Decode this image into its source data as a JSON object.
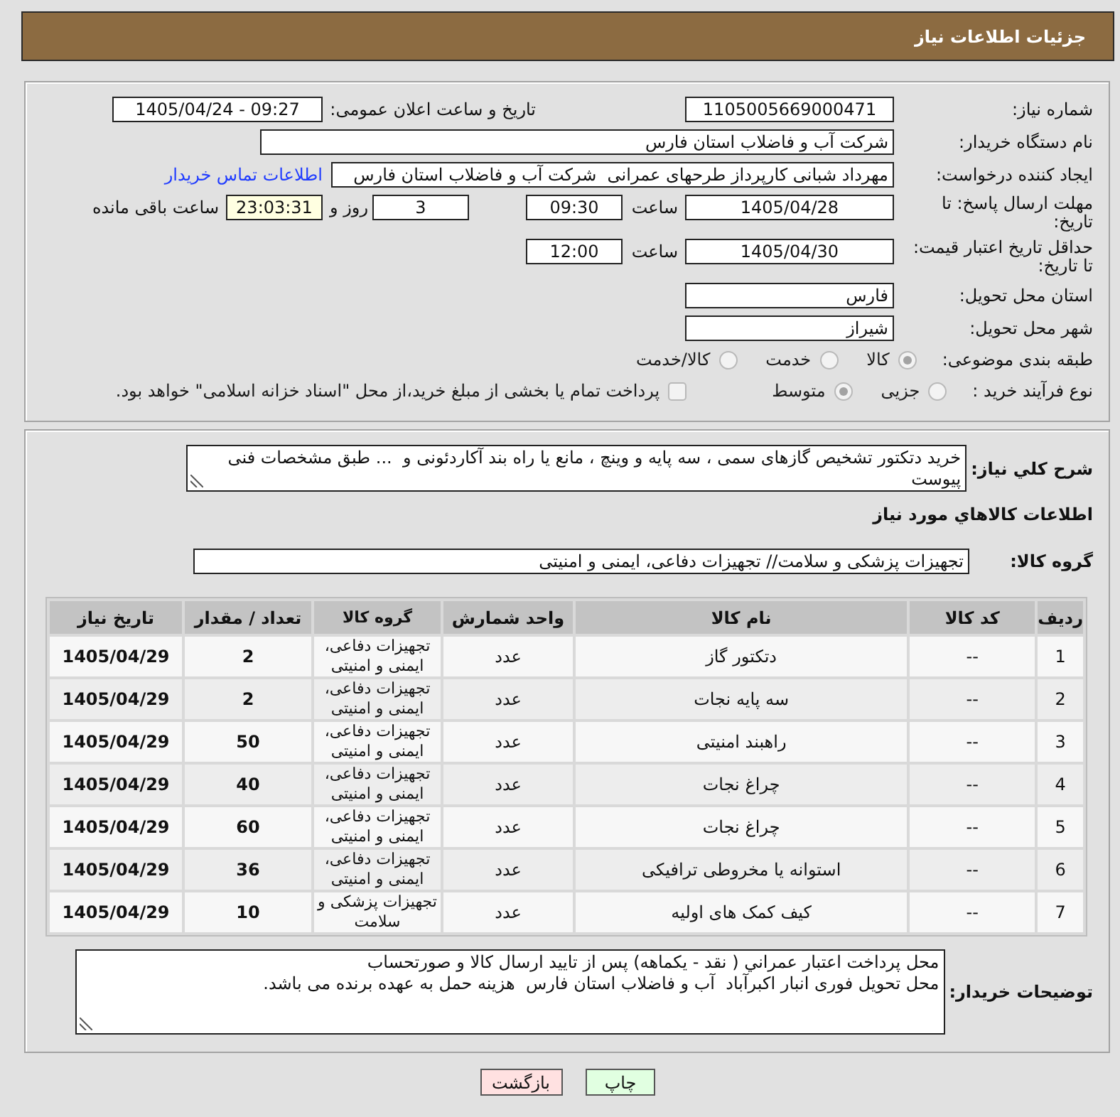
{
  "header": {
    "title": "جزئیات اطلاعات نیاز"
  },
  "details": {
    "need_number": {
      "label": "شماره نیاز:",
      "value": "1105005669000471"
    },
    "announce_datetime": {
      "label": "تاریخ و ساعت اعلان عمومی:",
      "value": "1405/04/24 - 09:27"
    },
    "buyer_org": {
      "label": "نام دستگاه خریدار:",
      "value": "شرکت آب و فاضلاب استان فارس"
    },
    "requester": {
      "label": "ایجاد کننده درخواست:",
      "value": "مهرداد شبانی کارپرداز طرحهای عمرانی  شرکت آب و فاضلاب استان فارس",
      "link": "اطلاعات تماس خریدار"
    },
    "response_deadline": {
      "label": "مهلت ارسال پاسخ: تا تاریخ:",
      "date": "1405/04/28",
      "time_label": "ساعت",
      "time": "09:30",
      "days": "3",
      "days_label": "روز و",
      "remaining": "23:03:31",
      "remaining_label": "ساعت باقی مانده"
    },
    "price_validity": {
      "label": "حداقل تاریخ اعتبار قیمت: تا تاریخ:",
      "date": "1405/04/30",
      "time_label": "ساعت",
      "time": "12:00"
    },
    "delivery_province": {
      "label": "استان محل تحویل:",
      "value": "فارس"
    },
    "delivery_city": {
      "label": "شهر محل تحویل:",
      "value": "شیراز"
    },
    "classification": {
      "label": "طبقه بندی موضوعی:",
      "disabled": true,
      "options": [
        {
          "label": "کالا",
          "selected": true
        },
        {
          "label": "خدمت",
          "selected": false
        },
        {
          "label": "کالا/خدمت",
          "selected": false
        }
      ]
    },
    "purchase_process": {
      "label": "نوع فرآیند خرید :",
      "disabled": true,
      "options": [
        {
          "label": "جزیی",
          "selected": false
        },
        {
          "label": "متوسط",
          "selected": true
        }
      ],
      "treasury_checkbox": {
        "label": "پرداخت تمام یا بخشی از مبلغ خرید،از محل \"اسناد خزانه اسلامی\" خواهد بود.",
        "checked": false
      }
    }
  },
  "description": {
    "label": "شرح كلي نياز:",
    "value": "خرید دتکتور تشخیص گازهای سمی ، سه پایه و وینچ ، مانع یا راه بند آکاردئونی و  ... طبق مشخصات فنی پیوست"
  },
  "goods": {
    "title": "اطلاعات كالاهاي مورد نياز",
    "group_label": "گروه کالا:",
    "group_value": "تجهیزات پزشکی و سلامت// تجهیزات دفاعی، ایمنی و امنیتی",
    "table": {
      "columns": [
        "ردیف",
        "کد کالا",
        "نام کالا",
        "واحد شمارش",
        "گروه کالا",
        "تعداد / مقدار",
        "تاریخ نیاز"
      ],
      "rows": [
        {
          "row": "1",
          "code": "--",
          "name": "دتکتور گاز",
          "unit": "عدد",
          "group": "تجهیزات دفاعی، ایمنی و امنیتی",
          "quantity": "2",
          "date": "1405/04/29"
        },
        {
          "row": "2",
          "code": "--",
          "name": "سه پایه نجات",
          "unit": "عدد",
          "group": "تجهیزات دفاعی، ایمنی و امنیتی",
          "quantity": "2",
          "date": "1405/04/29"
        },
        {
          "row": "3",
          "code": "--",
          "name": "راهبند امنیتی",
          "unit": "عدد",
          "group": "تجهیزات دفاعی، ایمنی و امنیتی",
          "quantity": "50",
          "date": "1405/04/29"
        },
        {
          "row": "4",
          "code": "--",
          "name": "چراغ نجات",
          "unit": "عدد",
          "group": "تجهیزات دفاعی، ایمنی و امنیتی",
          "quantity": "40",
          "date": "1405/04/29"
        },
        {
          "row": "5",
          "code": "--",
          "name": "چراغ نجات",
          "unit": "عدد",
          "group": "تجهیزات دفاعی، ایمنی و امنیتی",
          "quantity": "60",
          "date": "1405/04/29"
        },
        {
          "row": "6",
          "code": "--",
          "name": "استوانه یا مخروطی ترافیکی",
          "unit": "عدد",
          "group": "تجهیزات دفاعی، ایمنی و امنیتی",
          "quantity": "36",
          "date": "1405/04/29"
        },
        {
          "row": "7",
          "code": "--",
          "name": "کیف کمک های اولیه",
          "unit": "عدد",
          "group": "تجهیزات پزشکی و سلامت",
          "quantity": "10",
          "date": "1405/04/29"
        }
      ]
    }
  },
  "buyer_notes": {
    "label": "توضیحات خریدار:",
    "value": "محل پرداخت اعتبار عمراني ( نقد - یکماهه) پس از تایید ارسال کالا و صورتحساب\nمحل تحویل فوری انبار اکبرآباد  آب و فاضلاب استان فارس  هزینه حمل به عهده برنده می باشد."
  },
  "buttons": [
    {
      "kind": "print",
      "label": "چاپ"
    },
    {
      "kind": "back",
      "label": "بازگشت"
    }
  ]
}
